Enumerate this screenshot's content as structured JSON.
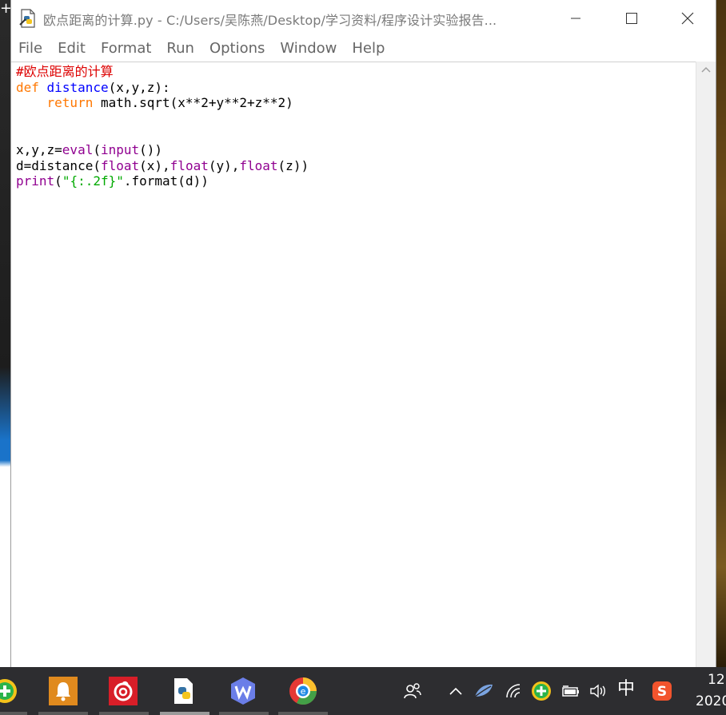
{
  "window": {
    "title": "欧点距离的计算.py - C:/Users/吴陈燕/Desktop/学习资料/程序设计实验报告..."
  },
  "menu": [
    "File",
    "Edit",
    "Format",
    "Run",
    "Options",
    "Window",
    "Help"
  ],
  "code": {
    "lines": [
      [
        {
          "t": "#欧点距离的计算",
          "c": "comment"
        }
      ],
      [
        {
          "t": "def",
          "c": "kw"
        },
        {
          "t": " "
        },
        {
          "t": "distance",
          "c": "def"
        },
        {
          "t": "(x,y,z):"
        }
      ],
      [
        {
          "t": "    "
        },
        {
          "t": "return",
          "c": "kw"
        },
        {
          "t": " math.sqrt(x**2+y**2+z**2)"
        }
      ],
      [],
      [],
      [
        {
          "t": "x,y,z="
        },
        {
          "t": "eval",
          "c": "builtin"
        },
        {
          "t": "("
        },
        {
          "t": "input",
          "c": "builtin"
        },
        {
          "t": "())"
        }
      ],
      [
        {
          "t": "d=distance("
        },
        {
          "t": "float",
          "c": "builtin"
        },
        {
          "t": "(x),"
        },
        {
          "t": "float",
          "c": "builtin"
        },
        {
          "t": "(y),"
        },
        {
          "t": "float",
          "c": "builtin"
        },
        {
          "t": "(z))"
        }
      ],
      [
        {
          "t": "print",
          "c": "builtin"
        },
        {
          "t": "("
        },
        {
          "t": "\"{:.2f}\"",
          "c": "str"
        },
        {
          "t": ".format(d))"
        }
      ]
    ]
  },
  "taskbar": {
    "ime_label": "中",
    "clock_time": "12",
    "clock_date": "2020"
  },
  "colors": {
    "comment": "#dd0000",
    "keyword": "#ff7700",
    "definition": "#0000ff",
    "builtin": "#900090",
    "string": "#00aa00",
    "taskbar": "#2d2d30"
  }
}
